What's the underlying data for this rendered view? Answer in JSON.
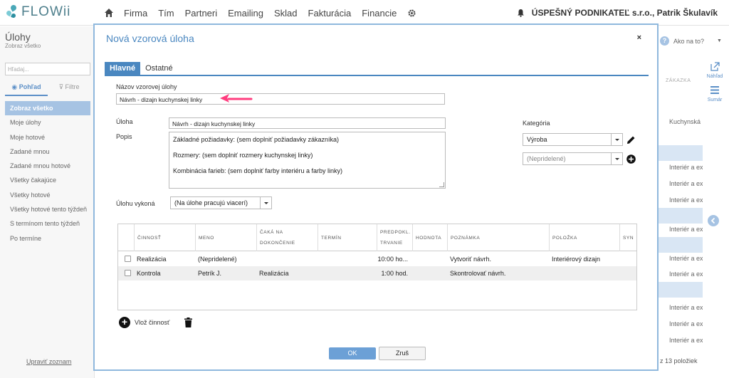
{
  "app": {
    "logo": "FLOWii"
  },
  "nav": {
    "items": [
      "Firma",
      "Tím",
      "Partneri",
      "Emailing",
      "Sklad",
      "Fakturácia",
      "Financie"
    ],
    "company": "ÚSPEŠNÝ PODNIKATEĽ s.r.o., Patrik Škulavík"
  },
  "sidebar": {
    "title": "Úlohy",
    "subtitle": "Zobraz všetko",
    "search_placeholder": "Hľadaj...",
    "tab_view": "Pohľad",
    "tab_filter": "Filtre",
    "items": [
      "Zobraz všetko",
      "Moje úlohy",
      "Moje hotové",
      "Zadané mnou",
      "Zadané mnou hotové",
      "Všetky čakajúce",
      "Všetky hotové",
      "Všetky hotové tento týždeň",
      "S termínom tento týždeň",
      "Po termíne"
    ],
    "active_index": 0,
    "footer_link": "Upraviť zoznam"
  },
  "right_panel": {
    "help": "Ako na to?",
    "preview": "Náhľad",
    "summary": "Sumár",
    "column_header": "ZÁKAZKA",
    "rows": [
      "Kuchynská",
      "Interiér a ex",
      "Interiér a ex",
      "Interiér a ex",
      "Interiér a ex",
      "Interiér a ex",
      "Interiér a ex",
      "Interiér a ex",
      "Interiér a ex",
      "Interiér a ex",
      "Interiér a ex"
    ],
    "count": "z 13 položiek"
  },
  "modal": {
    "title": "Nová vzorová úloha",
    "close": "×",
    "tabs": [
      "Hlavné",
      "Ostatné"
    ],
    "active_tab": 0,
    "template_name_label": "Názov vzorovej úlohy",
    "template_name_value": "Návrh - dizajn kuchynskej linky",
    "task_label": "Úloha",
    "task_value": "Návrh - dizajn kuchynskej linky",
    "description_label": "Popis",
    "description_lines": [
      "Základné požiadavky: (sem doplniť požiadavky zákazníka)",
      "Rozmery: (sem doplniť rozmery kuchynskej linky)",
      "Kombinácia farieb: (sem doplniť farby interiéru a farby linky)"
    ],
    "category_label": "Kategória",
    "category_value": "Výroba",
    "category2_value": "(Nepridelené)",
    "assignee_label": "Úlohu vykoná",
    "assignee_value": "(Na úlohe pracujú viacerí)",
    "table": {
      "headers": [
        "ČINNOSŤ",
        "MENO",
        "ČAKÁ NA DOKONČENIE",
        "TERMÍN",
        "PREDPOKL. TRVANIE",
        "HODNOTA",
        "POZNÁMKA",
        "POLOŽKA",
        "SYN"
      ],
      "rows": [
        {
          "activity": "Realizácia",
          "name": "(Nepridelené)",
          "waits": "",
          "deadline": "",
          "duration": "10:00 ho...",
          "value": "",
          "note": "Vytvoriť návrh.",
          "item": "Interiérový dizajn",
          "syn": ""
        },
        {
          "activity": "Kontrola",
          "name": "Petrík J.",
          "waits": "Realizácia",
          "deadline": "",
          "duration": "1:00 hod.",
          "value": "",
          "note": "Skontrolovať návrh.",
          "item": "",
          "syn": ""
        }
      ]
    },
    "add_activity": "Vlož činnosť",
    "ok": "OK",
    "cancel": "Zruš"
  },
  "colors": {
    "accent": "#4a87c0",
    "annotation_arrow": "#ff3d7f",
    "sidebar_active": "#a6c3e3"
  }
}
